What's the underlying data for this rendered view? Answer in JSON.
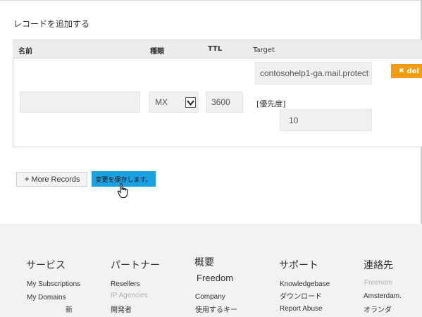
{
  "section_title": "レコードを追加する",
  "table": {
    "headers": {
      "name": "名前",
      "type": "種類",
      "ttl": "TTL",
      "target": "Target"
    }
  },
  "record": {
    "name_value": "",
    "type_value": "MX",
    "ttl_value": "3600",
    "target_value": "contosohelp1-ga.mail.protect",
    "priority_label": "[優先度]",
    "priority_value": "10",
    "delete_label": "del"
  },
  "actions": {
    "more_records": "More Records",
    "save_changes": "変更を保存します。"
  },
  "footer": {
    "columns": [
      {
        "heading": "サービス",
        "links": [
          "My Subscriptions",
          "My Domains",
          "新"
        ]
      },
      {
        "heading": "パートナー",
        "links": [
          "Resellers",
          "IP Agencies",
          "開発者"
        ]
      },
      {
        "heading": "概要",
        "links": [
          "Freedom",
          "Company",
          "使用するキー"
        ]
      },
      {
        "heading": "サポート",
        "links": [
          "Knowledgebase",
          "ダウンロード",
          "Report Abuse"
        ]
      },
      {
        "heading": "連絡先",
        "links": [
          "Freenom",
          "Amsterdam.",
          "オランダ"
        ]
      }
    ]
  },
  "colors": {
    "delete_button": "#f39c12",
    "save_button": "#1ba1e2",
    "footer_bg": "#f2f2f2"
  }
}
